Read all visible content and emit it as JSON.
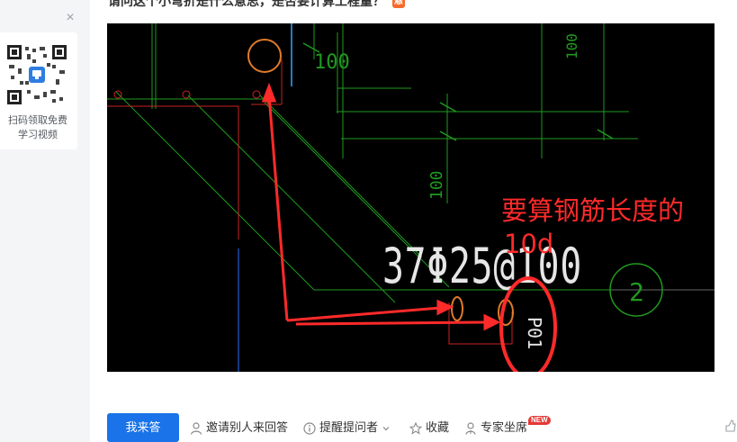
{
  "sidebar": {
    "close_icon": "×",
    "qr_caption": "扫码领取免费学习视频"
  },
  "question": {
    "title_fragment": "请问这个小弯折是什么意思，是否要计算工程量？",
    "badge": "悬"
  },
  "drawing": {
    "annotation_line1": "要算钢筋长度的",
    "annotation_line2": "10d",
    "rebar_label": "37Φ25@100",
    "dim_top": "100",
    "dim_mid": "100",
    "dim_right_top": "100",
    "grid_bubble": "2",
    "section_label": "P01",
    "annotation_color": "#ff2a2a"
  },
  "actions": {
    "answer": "我来答",
    "invite": "邀请别人来回答",
    "remind": "提醒提问者",
    "favorite": "收藏",
    "expert": "专家坐席",
    "expert_badge": "NEW"
  }
}
